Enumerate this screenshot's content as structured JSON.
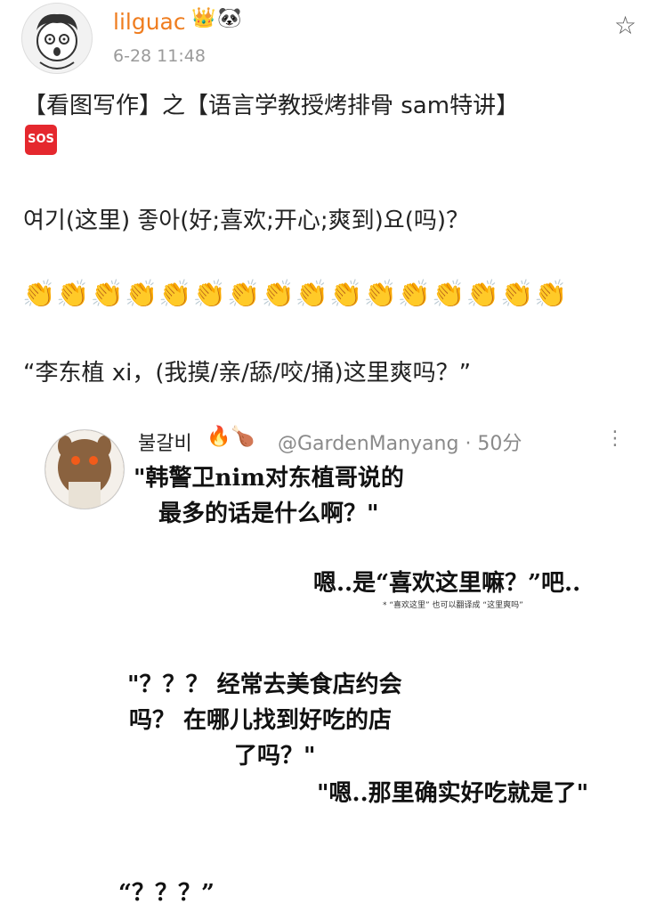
{
  "header": {
    "username": "lilguac",
    "badges": "👑🐼",
    "time": "6-28 11:48"
  },
  "post": {
    "line1": "【看图写作】之【语言学教授烤排骨 sam特讲】",
    "sos": "SOS",
    "line2": "여기(这里) 좋아(好;喜欢;开心;爽到)요(吗)？",
    "claps": "👏👏👏👏👏👏👏👏👏👏👏👏👏👏👏👏",
    "line3": "“李东植 xi，(我摸/亲/舔/咬/捅)这里爽吗？”"
  },
  "comment": {
    "user": "불갈비",
    "user_emoji": "🔥🍗",
    "handle": "@GardenManyang · 50分",
    "q1_a": "\"韩警卫nim对东植哥说的",
    "q1_b": "最多的话是什么啊？\"",
    "a1": "嗯..是“喜欢这里嘛？”吧..",
    "note": "* “喜欢这里” 也可以翻译成 “这里爽吗”",
    "q2_a": "\"？？？ 经常去美食店约会",
    "q2_b": "吗？ 在哪儿找到好吃的店",
    "q2_c": "了吗？\"",
    "a2": "\"嗯..那里确实好吃就是了\"",
    "q3": "“？？？”"
  },
  "icons": {
    "star": "star-icon",
    "more": "more-vertical-icon",
    "avatar": "avatar-image",
    "comment_avatar": "comment-avatar-image"
  },
  "colors": {
    "username": "#ef7d1f",
    "sos": "#e5282e",
    "meta": "#9a9a9a"
  }
}
